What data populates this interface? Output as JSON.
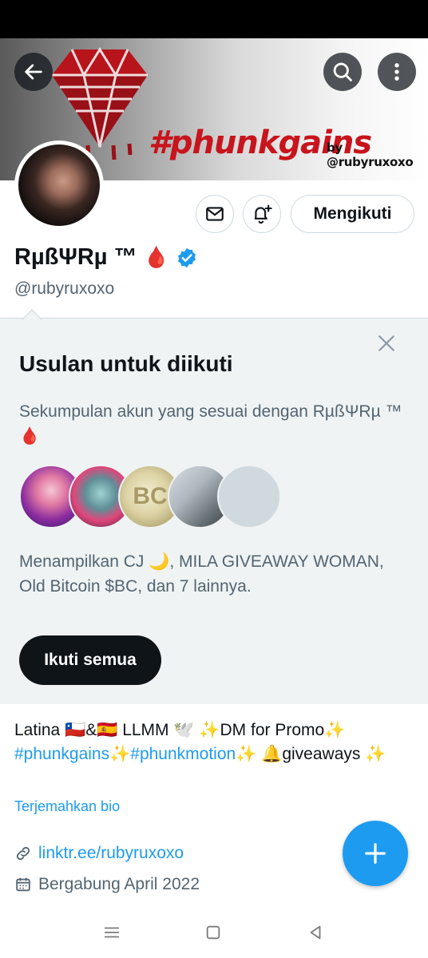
{
  "banner": {
    "title": "#phunkgains",
    "byline": "by @rubyruxoxo"
  },
  "profile": {
    "display_name": "RµßΨRµ ™",
    "name_emoji": "🩸",
    "handle": "@rubyruxoxo",
    "follow_label": "Mengikuti",
    "verified_color": "#1d9bf0"
  },
  "suggestions": {
    "title": "Usulan untuk diikuti",
    "description": "Sekumpulan akun yang sesuai dengan RµßΨRµ ™ 🩸",
    "avatar_badge": "BC",
    "summary": "Menampilkan CJ 🌙, MILA GIVEAWAY WOMAN, Old Bitcoin $BC, dan 7 lainnya.",
    "follow_all_label": "Ikuti semua"
  },
  "bio": {
    "line1": "Latina 🇨🇱&🇪🇸      LLMM 🕊️ ✨DM for Promo✨",
    "hashtag1": "#phunkgains",
    "sparkle1": "✨",
    "hashtag2": "#phunkmotion",
    "rest": "✨ 🔔giveaways ✨",
    "translate_label": "Terjemahkan bio"
  },
  "meta": {
    "link": "linktr.ee/rubyruxoxo",
    "joined": "Bergabung April 2022"
  },
  "icons": {
    "back": "arrow-left-icon",
    "search": "search-icon",
    "more": "more-vertical-icon",
    "mail": "mail-icon",
    "bell": "bell-plus-icon",
    "close": "close-icon",
    "link": "link-icon",
    "calendar": "calendar-icon",
    "compose": "plus-icon"
  },
  "colors": {
    "accent": "#1d9bf0",
    "banner_title": "#c8141c",
    "text": "#0f1419",
    "secondary": "#536471"
  }
}
